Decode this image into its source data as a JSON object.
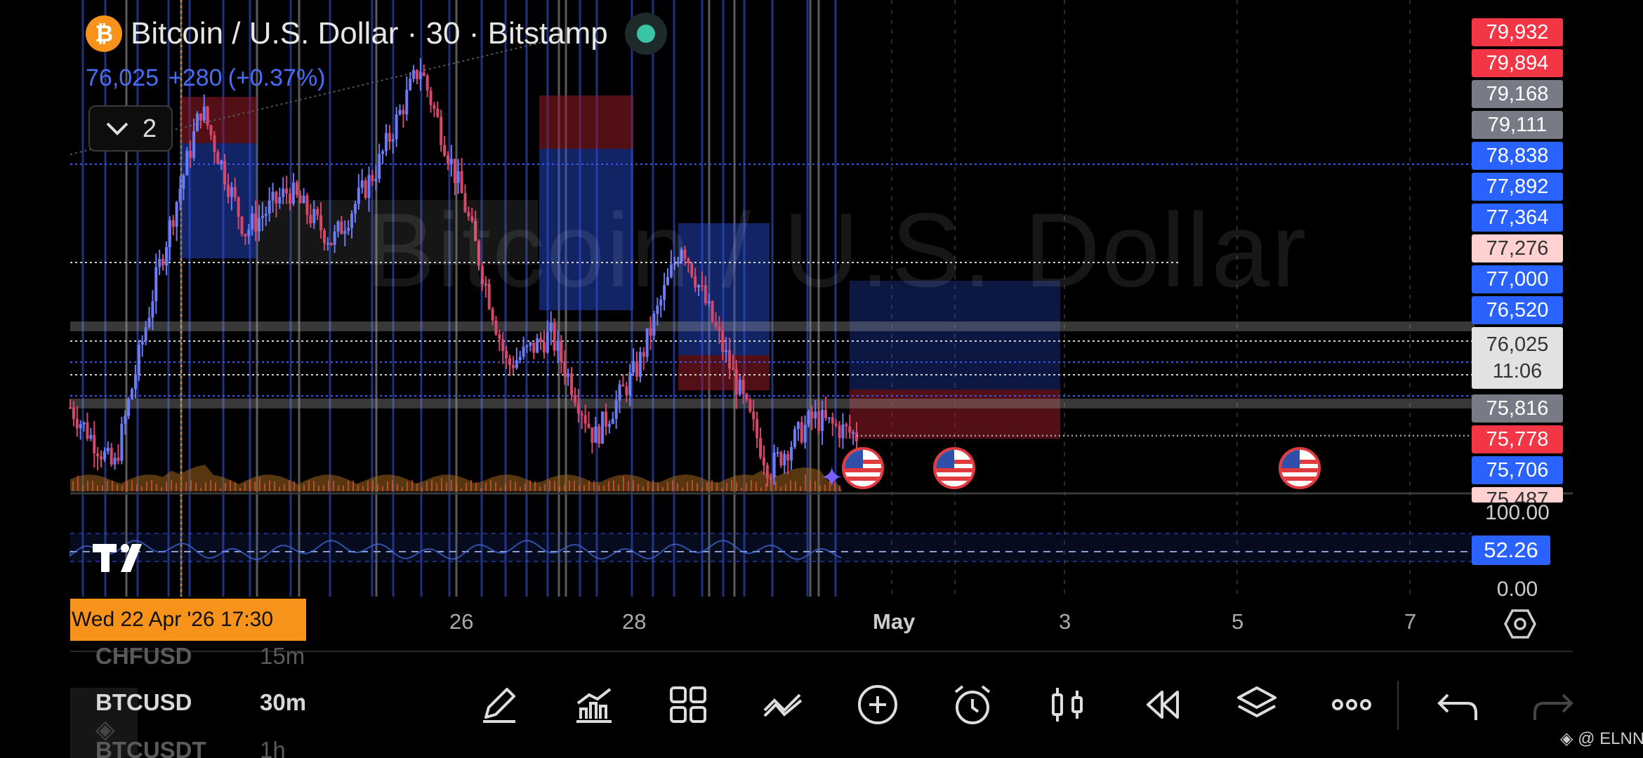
{
  "header": {
    "title": "Bitcoin / U.S. Dollar · 30 · Bitstamp",
    "logo_glyph": "₿",
    "last_price": "76,025",
    "change": "+280",
    "change_pct": "(+0.37%)",
    "indicator_count": "2"
  },
  "watermark": "Bitcoin / U.S. Dollar",
  "price_scale": [
    {
      "value": "79,932",
      "color": "#f23645"
    },
    {
      "value": "79,894",
      "color": "#f23645"
    },
    {
      "value": "79,168",
      "color": "#787b86"
    },
    {
      "value": "79,111",
      "color": "#787b86"
    },
    {
      "value": "78,838",
      "color": "#2962ff"
    },
    {
      "value": "77,892",
      "color": "#2962ff"
    },
    {
      "value": "77,364",
      "color": "#2962ff"
    },
    {
      "value": "77,276",
      "color": "#ffd1d1"
    },
    {
      "value": "77,000",
      "color": "#2962ff"
    },
    {
      "value": "76,520",
      "color": "#2962ff"
    },
    {
      "value": "75,816",
      "color": "#787b86"
    },
    {
      "value": "75,778",
      "color": "#f23645"
    },
    {
      "value": "75,706",
      "color": "#2962ff"
    },
    {
      "value": "75,487",
      "color": "#ffd1d1"
    }
  ],
  "current_price": {
    "value": "76,025",
    "countdown": "11:06"
  },
  "oscillator": {
    "top": "100.00",
    "value": "52.26",
    "bottom": "0.00"
  },
  "time_axis": {
    "cursor": "Wed 22 Apr '26   17:30",
    "labels": [
      "26",
      "28",
      "May",
      "3",
      "5",
      "7"
    ]
  },
  "watchlist": [
    {
      "symbol": "CHFUSD",
      "interval": "15m"
    },
    {
      "symbol": "BTCUSD",
      "interval": "30m"
    },
    {
      "symbol": "BTCUSDT",
      "interval": "1h"
    }
  ],
  "toolbar": [
    "pencil-icon",
    "indicators-icon",
    "layout-icon",
    "drawings-icon",
    "add-icon",
    "alert-icon",
    "candles-icon",
    "replay-icon",
    "layers-icon",
    "more-icon"
  ],
  "credit": "@ ELNN",
  "chart_data": {
    "type": "candlestick",
    "symbol": "Bitcoin / U.S. Dollar",
    "interval": "30",
    "exchange": "Bitstamp",
    "x_ticks": [
      "26",
      "28",
      "May",
      "3",
      "5",
      "7"
    ],
    "ylim": [
      75487,
      79932
    ],
    "last_price": 76025,
    "horizontal_levels": [
      78838,
      77276,
      77000,
      76520,
      76025,
      75816,
      75778,
      75706
    ],
    "price_path_approx": [
      [
        "Apr 22",
        76300
      ],
      [
        "Apr 22",
        75700
      ],
      [
        "Apr 23",
        77600
      ],
      [
        "Apr 23",
        79200
      ],
      [
        "Apr 24",
        78000
      ],
      [
        "Apr 25",
        78400
      ],
      [
        "Apr 26",
        77900
      ],
      [
        "Apr 27",
        78600
      ],
      [
        "Apr 27",
        79600
      ],
      [
        "Apr 28",
        78300
      ],
      [
        "Apr 28",
        76700
      ],
      [
        "Apr 29",
        77000
      ],
      [
        "Apr 29",
        76000
      ],
      [
        "Apr 30",
        76700
      ],
      [
        "Apr 30",
        77900
      ],
      [
        "May 1",
        76800
      ],
      [
        "May 1",
        75700
      ],
      [
        "May 1",
        76200
      ],
      [
        "May 1",
        76025
      ]
    ]
  }
}
